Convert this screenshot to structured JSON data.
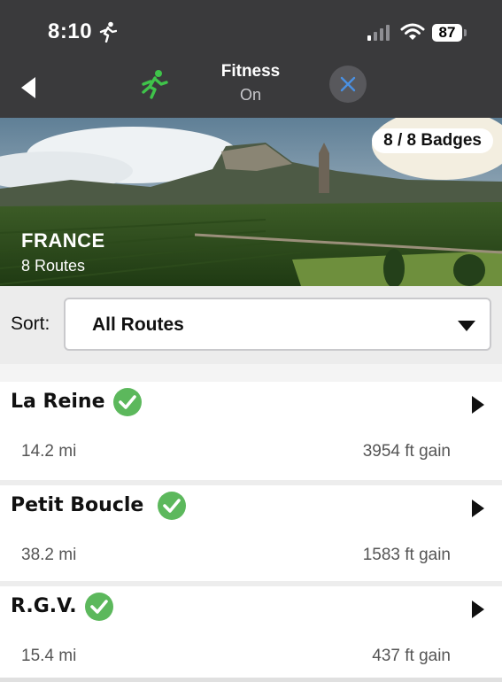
{
  "status_bar": {
    "time": "8:10",
    "battery": "87"
  },
  "header": {
    "fitness_title": "Fitness",
    "fitness_state": "On"
  },
  "hero": {
    "badges": "8 / 8 Badges",
    "region": "FRANCE",
    "route_count": "8 Routes"
  },
  "sort": {
    "label": "Sort:",
    "value": "All Routes"
  },
  "routes": [
    {
      "name": "La Reine",
      "distance": "14.2 mi",
      "gain": "3954 ft gain"
    },
    {
      "name": "Petit Boucle",
      "distance": "38.2 mi",
      "gain": "1583 ft gain"
    },
    {
      "name": "R.G.V.",
      "distance": "15.4 mi",
      "gain": "437 ft gain"
    }
  ],
  "colors": {
    "accent_green": "#5cb85c",
    "header_bg": "#3a3a3c",
    "close_x": "#4a90e2"
  }
}
